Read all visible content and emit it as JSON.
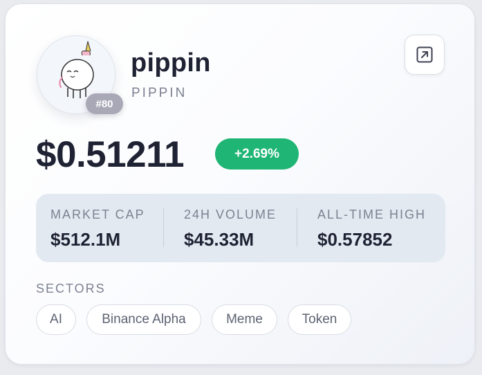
{
  "coin": {
    "name": "pippin",
    "symbol": "PIPPIN",
    "rank": "#80",
    "price": "$0.51211",
    "change_24h": "+2.69%"
  },
  "stats": [
    {
      "label": "MARKET CAP",
      "value": "$512.1M"
    },
    {
      "label": "24H VOLUME",
      "value": "$45.33M"
    },
    {
      "label": "ALL-TIME HIGH",
      "value": "$0.57852"
    }
  ],
  "sectors": {
    "label": "SECTORS",
    "tags": [
      "AI",
      "Binance Alpha",
      "Meme",
      "Token"
    ]
  },
  "icons": {
    "expand": "external-link-icon",
    "avatar": "pippin-unicorn-logo"
  },
  "colors": {
    "positive": "#1fb574",
    "rank_badge": "#a9a8b6",
    "stats_panel": "#e3e9f1",
    "text_primary": "#1f2233",
    "text_muted": "#7c8190"
  }
}
